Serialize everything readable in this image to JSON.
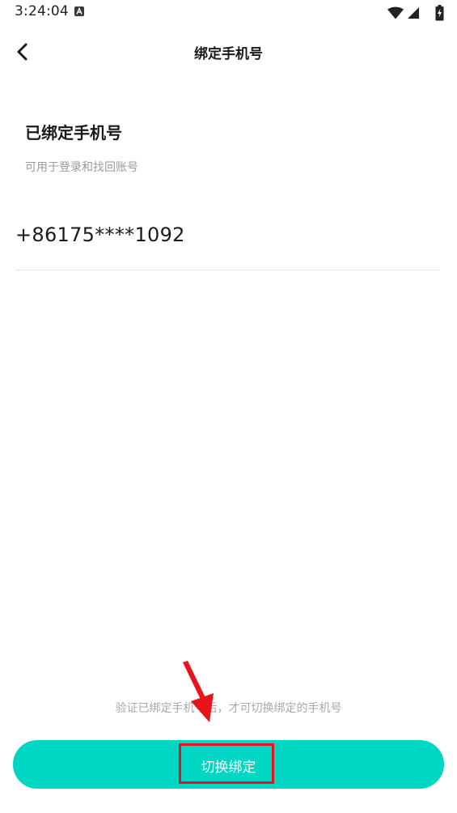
{
  "status_bar": {
    "time": "3:24:04",
    "notification_icon": "a-letter-icon",
    "wifi_icon": "wifi-icon",
    "signal_icon": "signal-icon",
    "battery_icon": "battery-charging-icon"
  },
  "header": {
    "back_icon": "chevron-left-icon",
    "title": "绑定手机号"
  },
  "bound_section": {
    "title": "已绑定手机号",
    "subtitle": "可用于登录和找回账号",
    "phone": "+86175****1092"
  },
  "footer": {
    "hint": "验证已绑定手机号后，才可切换绑定的手机号",
    "button_label": "切换绑定"
  },
  "colors": {
    "accent": "#00d6c4",
    "annotation": "#e8141c",
    "hint": "#a8a8ad"
  }
}
